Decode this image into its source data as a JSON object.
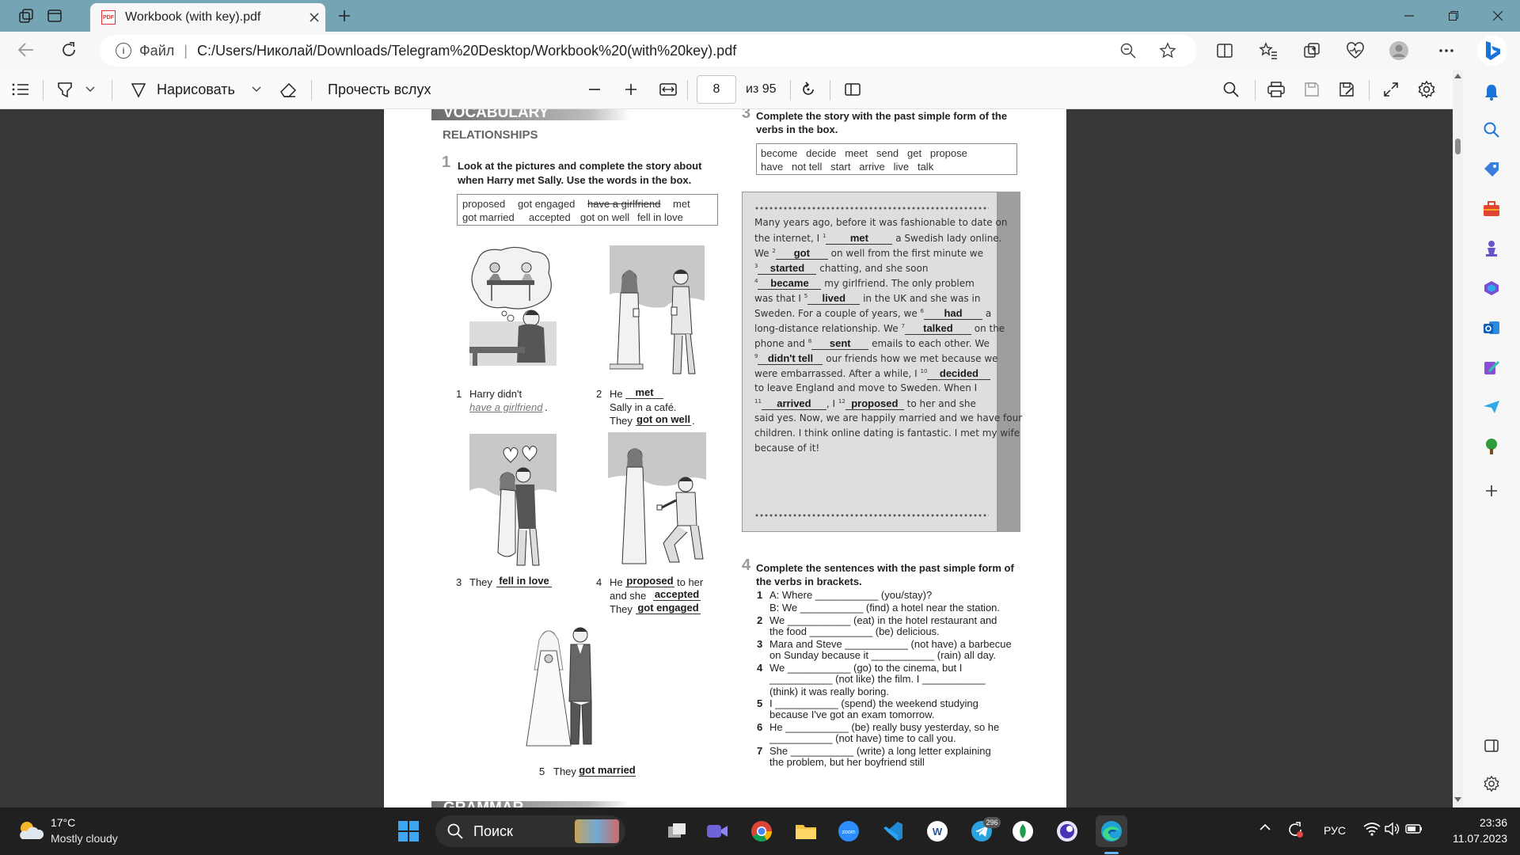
{
  "browser": {
    "tab_title": "Workbook (with key).pdf",
    "file_label": "Файл",
    "url": "C:/Users/Николай/Downloads/Telegram%20Desktop/Workbook%20(with%20key).pdf"
  },
  "pdf_toolbar": {
    "draw_label": "Нарисовать",
    "read_aloud_label": "Прочесть вслух",
    "page_number": "8",
    "page_total": "из 95"
  },
  "page": {
    "section_title": "VOCABULARY",
    "subsection": "RELATIONSHIPS",
    "ex1": {
      "number": "1",
      "instr1": "Look at the pictures and complete the story about",
      "instr2": "when Harry met Sally. Use the words in the box.",
      "box_row1": [
        "proposed",
        "got engaged",
        "have a girlfriend",
        "met"
      ],
      "box_row2": [
        "got married",
        "accepted",
        "got on well",
        "fell in love"
      ],
      "item1": {
        "num": "1",
        "a": "Harry didn't",
        "ans": "have a girlfriend",
        "end": "."
      },
      "item2": {
        "num": "2",
        "a": "He",
        "ans1": "met",
        "b": "Sally in a café.",
        "c": "They",
        "ans2": "got on well",
        "end": "."
      },
      "item3": {
        "num": "3",
        "a": "They",
        "ans": "fell in love"
      },
      "item4": {
        "num": "4",
        "a": "He",
        "ans1": "proposed",
        "b": "to her",
        "c": "and she",
        "ans2": "accepted",
        "d": "They",
        "ans3": "got engaged"
      },
      "item5": {
        "num": "5",
        "a": "They",
        "ans": "got married"
      }
    },
    "ex3": {
      "number": "3",
      "instr1": "Complete the story with the past simple form of the",
      "instr2": "verbs in the box.",
      "box_row1": "become   decide   meet   send   get   propose",
      "box_row2": "have   not tell   start   arrive   live   talk",
      "l1": "Many years ago, before it was fashionable to date on",
      "l2a": "the internet, I",
      "l2n": "1",
      "l2ans": "met",
      "l2b": "a Swedish lady online.",
      "l3a": "We",
      "l3n": "2",
      "l3ans": "got",
      "l3b": "on well from the first minute we",
      "l4n": "3",
      "l4ans": "started",
      "l4b": "chatting, and she soon",
      "l5n": "4",
      "l5ans": "became",
      "l5b": "my girlfriend. The only problem",
      "l6a": "was that I",
      "l6n": "5",
      "l6ans": "lived",
      "l6b": "in the UK and she was in",
      "l7a": "Sweden. For a couple of years, we",
      "l7n": "6",
      "l7ans": "had",
      "l7b": "a",
      "l8a": "long-distance relationship. We",
      "l8n": "7",
      "l8ans": "talked",
      "l8b": "on the",
      "l9a": "phone and",
      "l9n": "8",
      "l9ans": "sent",
      "l9b": "emails to each other. We",
      "l10n": "9",
      "l10ans": "didn't tell",
      "l10b": "our friends how we met because we",
      "l11a": "were embarrassed. After a while, I",
      "l11n": "10",
      "l11ans": "decided",
      "l12": "to leave England and move to Sweden. When I",
      "l13n": "11",
      "l13ans": "arrived",
      "l13m": ", I",
      "l13n2": "12",
      "l13ans2": "proposed",
      "l13b": "to her and she",
      "l14": "said yes. Now, we are happily married and we have four",
      "l15": "children. I think online dating is fantastic. I met my wife",
      "l16": "because of it!"
    },
    "ex4": {
      "number": "4",
      "instr1": "Complete the sentences with the past simple form of",
      "instr2": "the verbs in brackets.",
      "lines": [
        {
          "n": "1",
          "t": "A:  Where ___________ (you/stay)?"
        },
        {
          "n": "",
          "t": "B:  We ___________ (find) a hotel near the station."
        },
        {
          "n": "2",
          "t": "We ___________ (eat) in the hotel restaurant and"
        },
        {
          "n": "",
          "t": "the food ___________ (be) delicious."
        },
        {
          "n": "3",
          "t": "Mara and Steve ___________ (not have) a barbecue"
        },
        {
          "n": "",
          "t": "on Sunday because it ___________ (rain) all day."
        },
        {
          "n": "4",
          "t": "We ___________ (go) to the cinema, but I"
        },
        {
          "n": "",
          "t": "___________ (not like) the film. I ___________"
        },
        {
          "n": "",
          "t": "(think) it was really boring."
        },
        {
          "n": "5",
          "t": "I ___________ (spend) the weekend studying"
        },
        {
          "n": "",
          "t": "because I've got an exam tomorrow."
        },
        {
          "n": "6",
          "t": "He ___________ (be) really busy yesterday, so he"
        },
        {
          "n": "",
          "t": "___________ (not have) time to call you."
        },
        {
          "n": "7",
          "t": "She ___________ (write) a long letter explaining"
        },
        {
          "n": "",
          "t": "the problem, but her boyfriend still"
        }
      ]
    },
    "grammar_heading": "GRAMMAR"
  },
  "taskbar": {
    "temp": "17°C",
    "weather": "Mostly cloudy",
    "search_label": "Поиск",
    "telegram_badge": "296",
    "lang": "РУС",
    "time": "23:36",
    "date": "11.07.2023"
  }
}
